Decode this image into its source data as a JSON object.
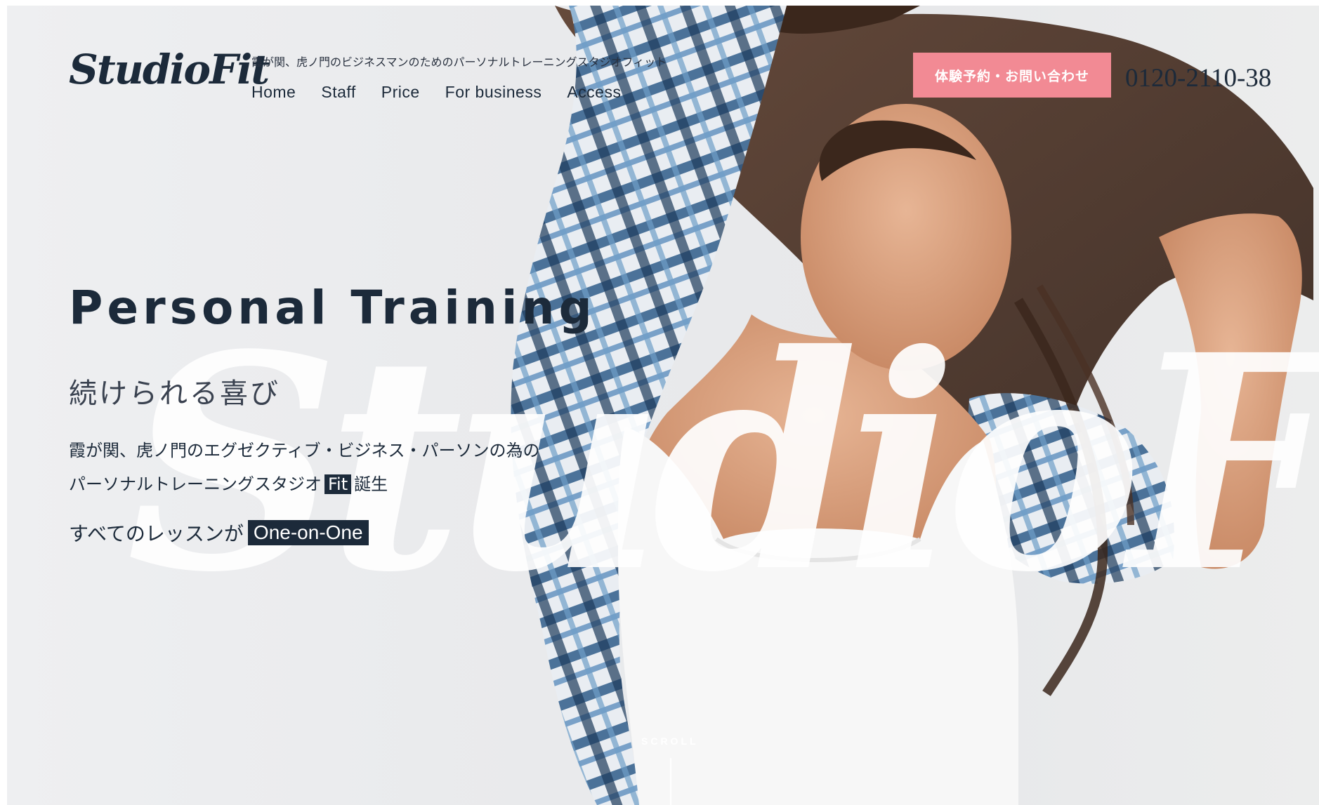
{
  "header": {
    "logo_text": "StudioFit",
    "tagline": "霞が関、虎ノ門のビジネスマンのためのパーソナルトレーニングスタジオフィット",
    "nav": [
      {
        "label": "Home"
      },
      {
        "label": "Staff"
      },
      {
        "label": "Price"
      },
      {
        "label": "For business"
      },
      {
        "label": "Access"
      }
    ],
    "cta_label": "体験予約・お問い合わせ",
    "phone": "0120-2110-38"
  },
  "hero": {
    "title": "Personal Training",
    "subtitle": "続けられる喜び",
    "desc_line1": "霞が関、虎ノ門のエグゼクティブ・ビジネス・パーソンの為の",
    "desc_line2_prefix": "パーソナルトレーニングスタジオ",
    "desc_line2_badge": "Fit",
    "desc_line2_suffix": "誕生",
    "lessons_prefix": "すべてのレッスンが",
    "lessons_badge": "One-on-One",
    "watermark_text": "StudioFit"
  },
  "scroll": {
    "label": "SCROLL"
  },
  "colors": {
    "navy": "#1c2a3a",
    "cta_pink": "#f28a94",
    "background": "#ececee"
  }
}
